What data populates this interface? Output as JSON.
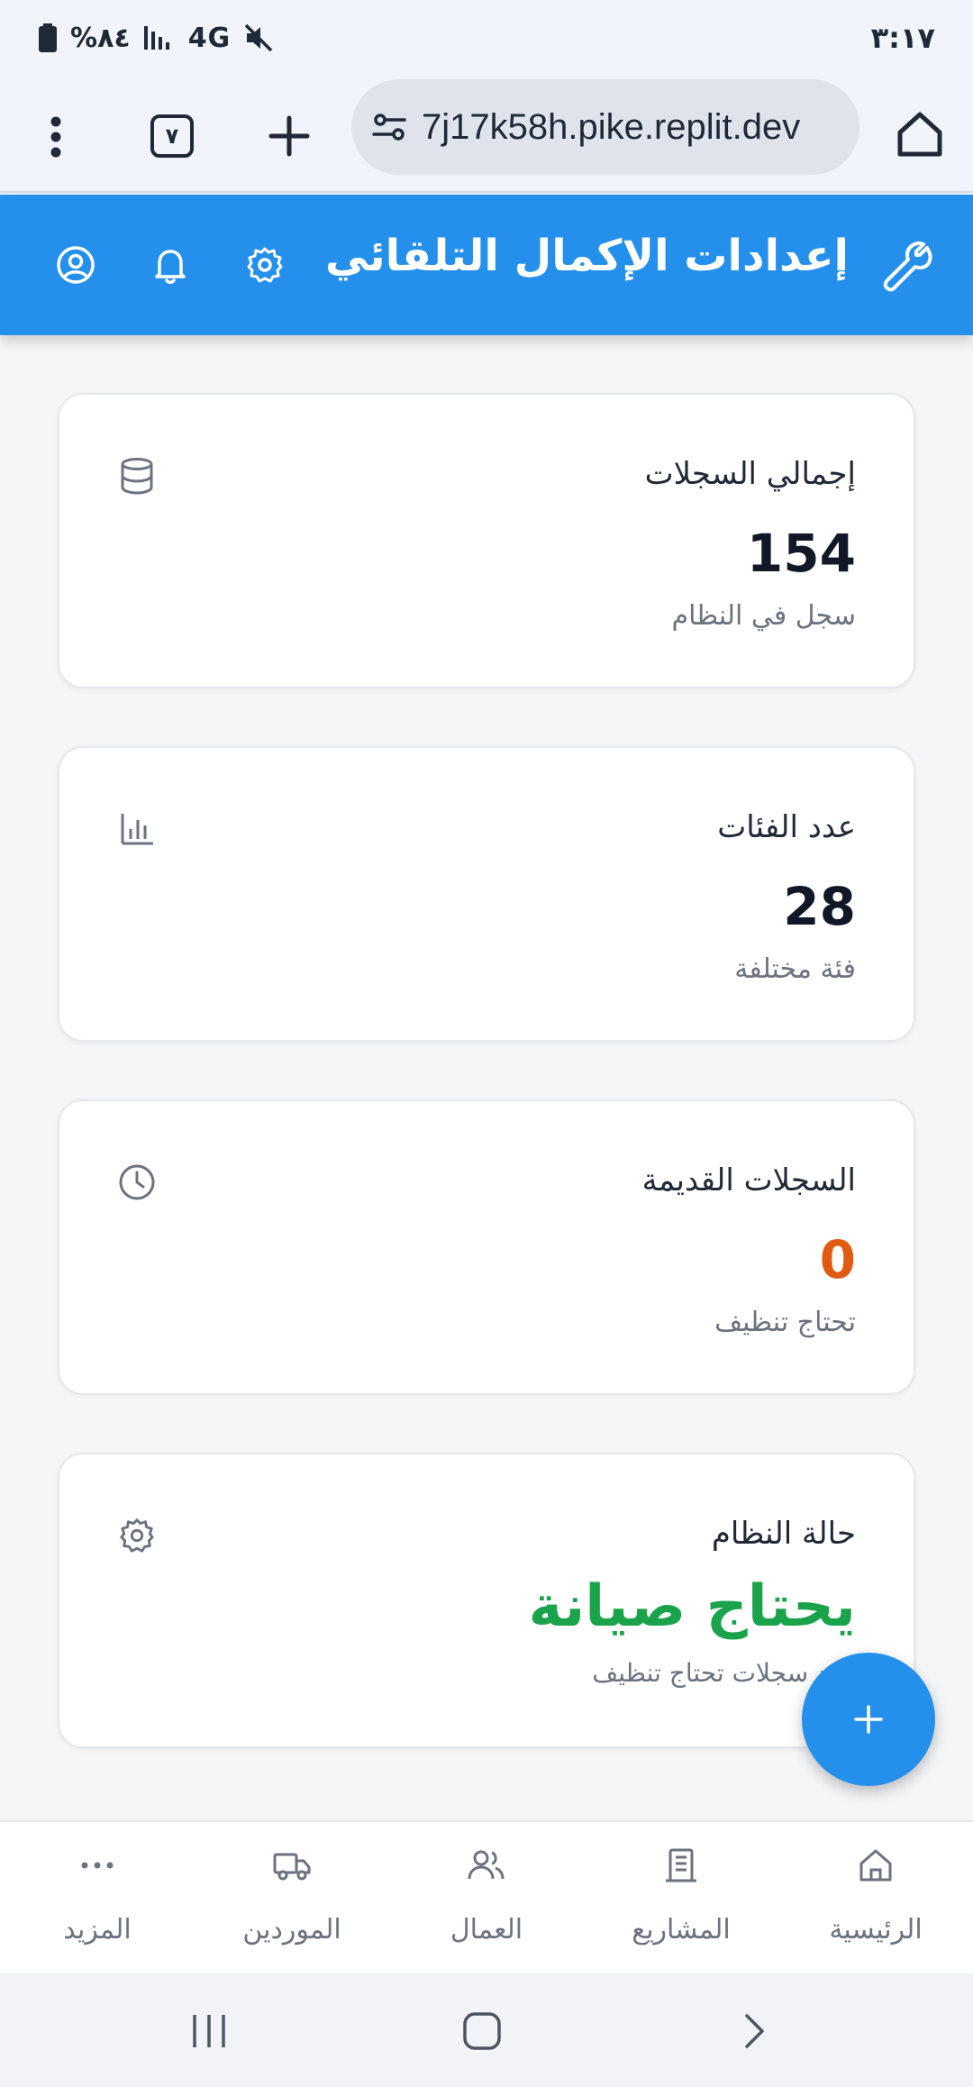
{
  "status_bar": {
    "time": "٣:١٧",
    "battery": "%٨٤",
    "network": "4G"
  },
  "browser": {
    "url": "7j17k58h.pike.replit.dev",
    "tab_count": "٧"
  },
  "app_header": {
    "title": "إعدادات الإكمال التلقائي"
  },
  "cards": [
    {
      "title": "إجمالي السجلات",
      "value": "154",
      "subtitle": "سجل في النظام",
      "icon": "database-icon"
    },
    {
      "title": "عدد الفئات",
      "value": "28",
      "subtitle": "فئة مختلفة",
      "icon": "bar-chart-icon"
    },
    {
      "title": "السجلات القديمة",
      "value": "0",
      "subtitle": "تحتاج تنظيف",
      "icon": "clock-icon",
      "value_color": "#e05a12"
    },
    {
      "title": "حالة النظام",
      "value": "يحتاج صيانة",
      "subtitle": "عدد سجلات تحتاج تنظيف",
      "icon": "gear-icon",
      "value_color": "#1aa34a"
    }
  ],
  "bottom_nav": [
    {
      "label": "الرئيسية",
      "icon": "home-icon"
    },
    {
      "label": "المشاريع",
      "icon": "building-icon"
    },
    {
      "label": "العمال",
      "icon": "users-icon"
    },
    {
      "label": "الموردين",
      "icon": "truck-icon"
    },
    {
      "label": "المزيد",
      "icon": "more-icon"
    }
  ],
  "colors": {
    "primary": "#2590ec",
    "orange": "#e05a12",
    "green": "#1aa34a"
  }
}
